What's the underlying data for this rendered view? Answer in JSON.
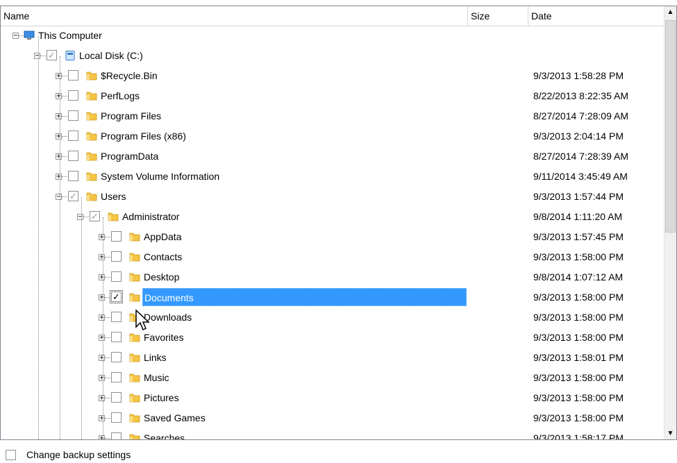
{
  "columns": {
    "name": "Name",
    "size": "Size",
    "date": "Date"
  },
  "tree": [
    {
      "level": 0,
      "label": "This Computer",
      "icon": "computer-icon",
      "expander": "minus",
      "check": "none",
      "date": ""
    },
    {
      "level": 1,
      "label": "Local Disk (C:)",
      "icon": "drive-icon",
      "expander": "minus",
      "check": "grey",
      "date": ""
    },
    {
      "level": 2,
      "label": "$Recycle.Bin",
      "icon": "folder-icon",
      "expander": "plus",
      "check": "empty",
      "date": "9/3/2013 1:58:28 PM"
    },
    {
      "level": 2,
      "label": "PerfLogs",
      "icon": "folder-icon",
      "expander": "plus",
      "check": "empty",
      "date": "8/22/2013 8:22:35 AM"
    },
    {
      "level": 2,
      "label": "Program Files",
      "icon": "folder-icon",
      "expander": "plus",
      "check": "empty",
      "date": "8/27/2014 7:28:09 AM"
    },
    {
      "level": 2,
      "label": "Program Files (x86)",
      "icon": "folder-icon",
      "expander": "plus",
      "check": "empty",
      "date": "9/3/2013 2:04:14 PM"
    },
    {
      "level": 2,
      "label": "ProgramData",
      "icon": "folder-icon",
      "expander": "plus",
      "check": "empty",
      "date": "8/27/2014 7:28:39 AM"
    },
    {
      "level": 2,
      "label": "System Volume Information",
      "icon": "folder-icon",
      "expander": "plus",
      "check": "empty",
      "date": "9/11/2014 3:45:49 AM"
    },
    {
      "level": 2,
      "label": "Users",
      "icon": "folder-icon",
      "expander": "minus",
      "check": "grey",
      "date": "9/3/2013 1:57:44 PM"
    },
    {
      "level": 3,
      "label": "Administrator",
      "icon": "folder-icon",
      "expander": "minus",
      "check": "grey",
      "date": "9/8/2014 1:11:20 AM"
    },
    {
      "level": 4,
      "label": "AppData",
      "icon": "folder-icon",
      "expander": "plus",
      "check": "empty",
      "date": "9/3/2013 1:57:45 PM"
    },
    {
      "level": 4,
      "label": "Contacts",
      "icon": "folder-icon",
      "expander": "plus",
      "check": "empty",
      "date": "9/3/2013 1:58:00 PM"
    },
    {
      "level": 4,
      "label": "Desktop",
      "icon": "folder-icon",
      "expander": "plus",
      "check": "empty",
      "date": "9/8/2014 1:07:12 AM"
    },
    {
      "level": 4,
      "label": "Documents",
      "icon": "folder-icon",
      "expander": "plus",
      "check": "checked",
      "date": "9/3/2013 1:58:00 PM",
      "selected": true
    },
    {
      "level": 4,
      "label": "Downloads",
      "icon": "folder-icon",
      "expander": "plus",
      "check": "empty",
      "date": "9/3/2013 1:58:00 PM"
    },
    {
      "level": 4,
      "label": "Favorites",
      "icon": "folder-icon",
      "expander": "plus",
      "check": "empty",
      "date": "9/3/2013 1:58:00 PM"
    },
    {
      "level": 4,
      "label": "Links",
      "icon": "folder-icon",
      "expander": "plus",
      "check": "empty",
      "date": "9/3/2013 1:58:01 PM"
    },
    {
      "level": 4,
      "label": "Music",
      "icon": "folder-icon",
      "expander": "plus",
      "check": "empty",
      "date": "9/3/2013 1:58:00 PM"
    },
    {
      "level": 4,
      "label": "Pictures",
      "icon": "folder-icon",
      "expander": "plus",
      "check": "empty",
      "date": "9/3/2013 1:58:00 PM"
    },
    {
      "level": 4,
      "label": "Saved Games",
      "icon": "folder-icon",
      "expander": "plus",
      "check": "empty",
      "date": "9/3/2013 1:58:00 PM"
    },
    {
      "level": 4,
      "label": "Searches",
      "icon": "folder-icon",
      "expander": "plus",
      "check": "empty",
      "date": "9/3/2013 1:58:17 PM"
    }
  ],
  "scrollbar": {
    "up": "▲",
    "down": "▼"
  },
  "footer": {
    "change_backup_label": "Change backup settings"
  },
  "colors": {
    "selection": "#3399ff",
    "folder": "#f6c445",
    "computer": "#3a8ee6"
  }
}
